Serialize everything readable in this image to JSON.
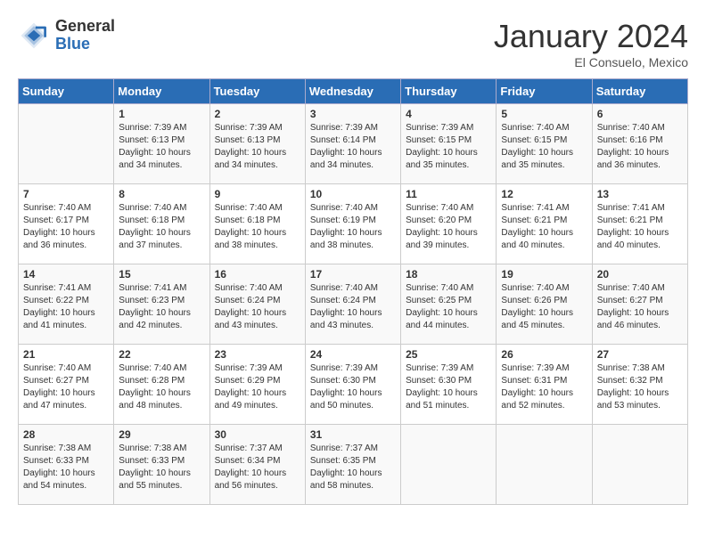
{
  "logo": {
    "general": "General",
    "blue": "Blue"
  },
  "title": "January 2024",
  "subtitle": "El Consuelo, Mexico",
  "days_header": [
    "Sunday",
    "Monday",
    "Tuesday",
    "Wednesday",
    "Thursday",
    "Friday",
    "Saturday"
  ],
  "weeks": [
    [
      {
        "num": "",
        "empty": true
      },
      {
        "num": "1",
        "sunrise": "7:39 AM",
        "sunset": "6:13 PM",
        "daylight": "10 hours and 34 minutes."
      },
      {
        "num": "2",
        "sunrise": "7:39 AM",
        "sunset": "6:13 PM",
        "daylight": "10 hours and 34 minutes."
      },
      {
        "num": "3",
        "sunrise": "7:39 AM",
        "sunset": "6:14 PM",
        "daylight": "10 hours and 34 minutes."
      },
      {
        "num": "4",
        "sunrise": "7:39 AM",
        "sunset": "6:15 PM",
        "daylight": "10 hours and 35 minutes."
      },
      {
        "num": "5",
        "sunrise": "7:40 AM",
        "sunset": "6:15 PM",
        "daylight": "10 hours and 35 minutes."
      },
      {
        "num": "6",
        "sunrise": "7:40 AM",
        "sunset": "6:16 PM",
        "daylight": "10 hours and 36 minutes."
      }
    ],
    [
      {
        "num": "7",
        "sunrise": "7:40 AM",
        "sunset": "6:17 PM",
        "daylight": "10 hours and 36 minutes."
      },
      {
        "num": "8",
        "sunrise": "7:40 AM",
        "sunset": "6:18 PM",
        "daylight": "10 hours and 37 minutes."
      },
      {
        "num": "9",
        "sunrise": "7:40 AM",
        "sunset": "6:18 PM",
        "daylight": "10 hours and 38 minutes."
      },
      {
        "num": "10",
        "sunrise": "7:40 AM",
        "sunset": "6:19 PM",
        "daylight": "10 hours and 38 minutes."
      },
      {
        "num": "11",
        "sunrise": "7:40 AM",
        "sunset": "6:20 PM",
        "daylight": "10 hours and 39 minutes."
      },
      {
        "num": "12",
        "sunrise": "7:41 AM",
        "sunset": "6:21 PM",
        "daylight": "10 hours and 40 minutes."
      },
      {
        "num": "13",
        "sunrise": "7:41 AM",
        "sunset": "6:21 PM",
        "daylight": "10 hours and 40 minutes."
      }
    ],
    [
      {
        "num": "14",
        "sunrise": "7:41 AM",
        "sunset": "6:22 PM",
        "daylight": "10 hours and 41 minutes."
      },
      {
        "num": "15",
        "sunrise": "7:41 AM",
        "sunset": "6:23 PM",
        "daylight": "10 hours and 42 minutes."
      },
      {
        "num": "16",
        "sunrise": "7:40 AM",
        "sunset": "6:24 PM",
        "daylight": "10 hours and 43 minutes."
      },
      {
        "num": "17",
        "sunrise": "7:40 AM",
        "sunset": "6:24 PM",
        "daylight": "10 hours and 43 minutes."
      },
      {
        "num": "18",
        "sunrise": "7:40 AM",
        "sunset": "6:25 PM",
        "daylight": "10 hours and 44 minutes."
      },
      {
        "num": "19",
        "sunrise": "7:40 AM",
        "sunset": "6:26 PM",
        "daylight": "10 hours and 45 minutes."
      },
      {
        "num": "20",
        "sunrise": "7:40 AM",
        "sunset": "6:27 PM",
        "daylight": "10 hours and 46 minutes."
      }
    ],
    [
      {
        "num": "21",
        "sunrise": "7:40 AM",
        "sunset": "6:27 PM",
        "daylight": "10 hours and 47 minutes."
      },
      {
        "num": "22",
        "sunrise": "7:40 AM",
        "sunset": "6:28 PM",
        "daylight": "10 hours and 48 minutes."
      },
      {
        "num": "23",
        "sunrise": "7:39 AM",
        "sunset": "6:29 PM",
        "daylight": "10 hours and 49 minutes."
      },
      {
        "num": "24",
        "sunrise": "7:39 AM",
        "sunset": "6:30 PM",
        "daylight": "10 hours and 50 minutes."
      },
      {
        "num": "25",
        "sunrise": "7:39 AM",
        "sunset": "6:30 PM",
        "daylight": "10 hours and 51 minutes."
      },
      {
        "num": "26",
        "sunrise": "7:39 AM",
        "sunset": "6:31 PM",
        "daylight": "10 hours and 52 minutes."
      },
      {
        "num": "27",
        "sunrise": "7:38 AM",
        "sunset": "6:32 PM",
        "daylight": "10 hours and 53 minutes."
      }
    ],
    [
      {
        "num": "28",
        "sunrise": "7:38 AM",
        "sunset": "6:33 PM",
        "daylight": "10 hours and 54 minutes."
      },
      {
        "num": "29",
        "sunrise": "7:38 AM",
        "sunset": "6:33 PM",
        "daylight": "10 hours and 55 minutes."
      },
      {
        "num": "30",
        "sunrise": "7:37 AM",
        "sunset": "6:34 PM",
        "daylight": "10 hours and 56 minutes."
      },
      {
        "num": "31",
        "sunrise": "7:37 AM",
        "sunset": "6:35 PM",
        "daylight": "10 hours and 58 minutes."
      },
      {
        "num": "",
        "empty": true
      },
      {
        "num": "",
        "empty": true
      },
      {
        "num": "",
        "empty": true
      }
    ]
  ],
  "labels": {
    "sunrise": "Sunrise:",
    "sunset": "Sunset:",
    "daylight": "Daylight:"
  }
}
